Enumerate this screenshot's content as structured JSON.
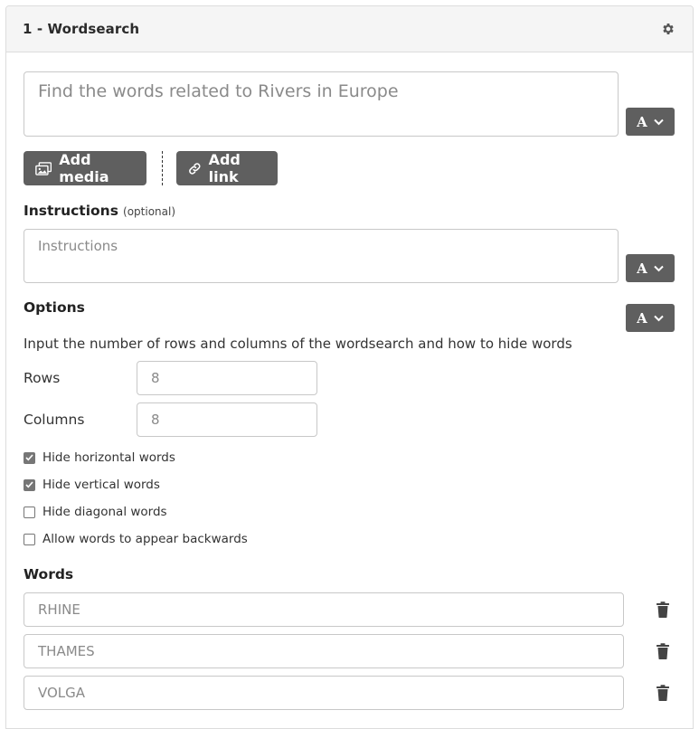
{
  "card": {
    "title": "1 - Wordsearch",
    "settings_icon": "gear-icon"
  },
  "question": {
    "placeholder": "Find the words related to Rivers in Europe"
  },
  "font_button": {
    "label": "A",
    "icon": "chevron-down-icon"
  },
  "media": {
    "add_media_label": "Add media",
    "add_link_label": "Add link"
  },
  "instructions": {
    "label": "Instructions",
    "optional": "(optional)",
    "placeholder": "Instructions"
  },
  "options": {
    "label": "Options",
    "description": "Input the number of rows and columns of the wordsearch and how to hide words",
    "rows_label": "Rows",
    "rows_value": "8",
    "columns_label": "Columns",
    "columns_value": "8",
    "checkboxes": [
      {
        "label": "Hide horizontal words",
        "checked": true
      },
      {
        "label": "Hide vertical words",
        "checked": true
      },
      {
        "label": "Hide diagonal words",
        "checked": false
      },
      {
        "label": "Allow words to appear backwards",
        "checked": false
      }
    ]
  },
  "words": {
    "label": "Words",
    "items": [
      "RHINE",
      "THAMES",
      "VOLGA"
    ]
  },
  "colors": {
    "button_bg": "#5f5f5f",
    "header_bg": "#f5f5f5",
    "border": "#c8c8c8"
  }
}
